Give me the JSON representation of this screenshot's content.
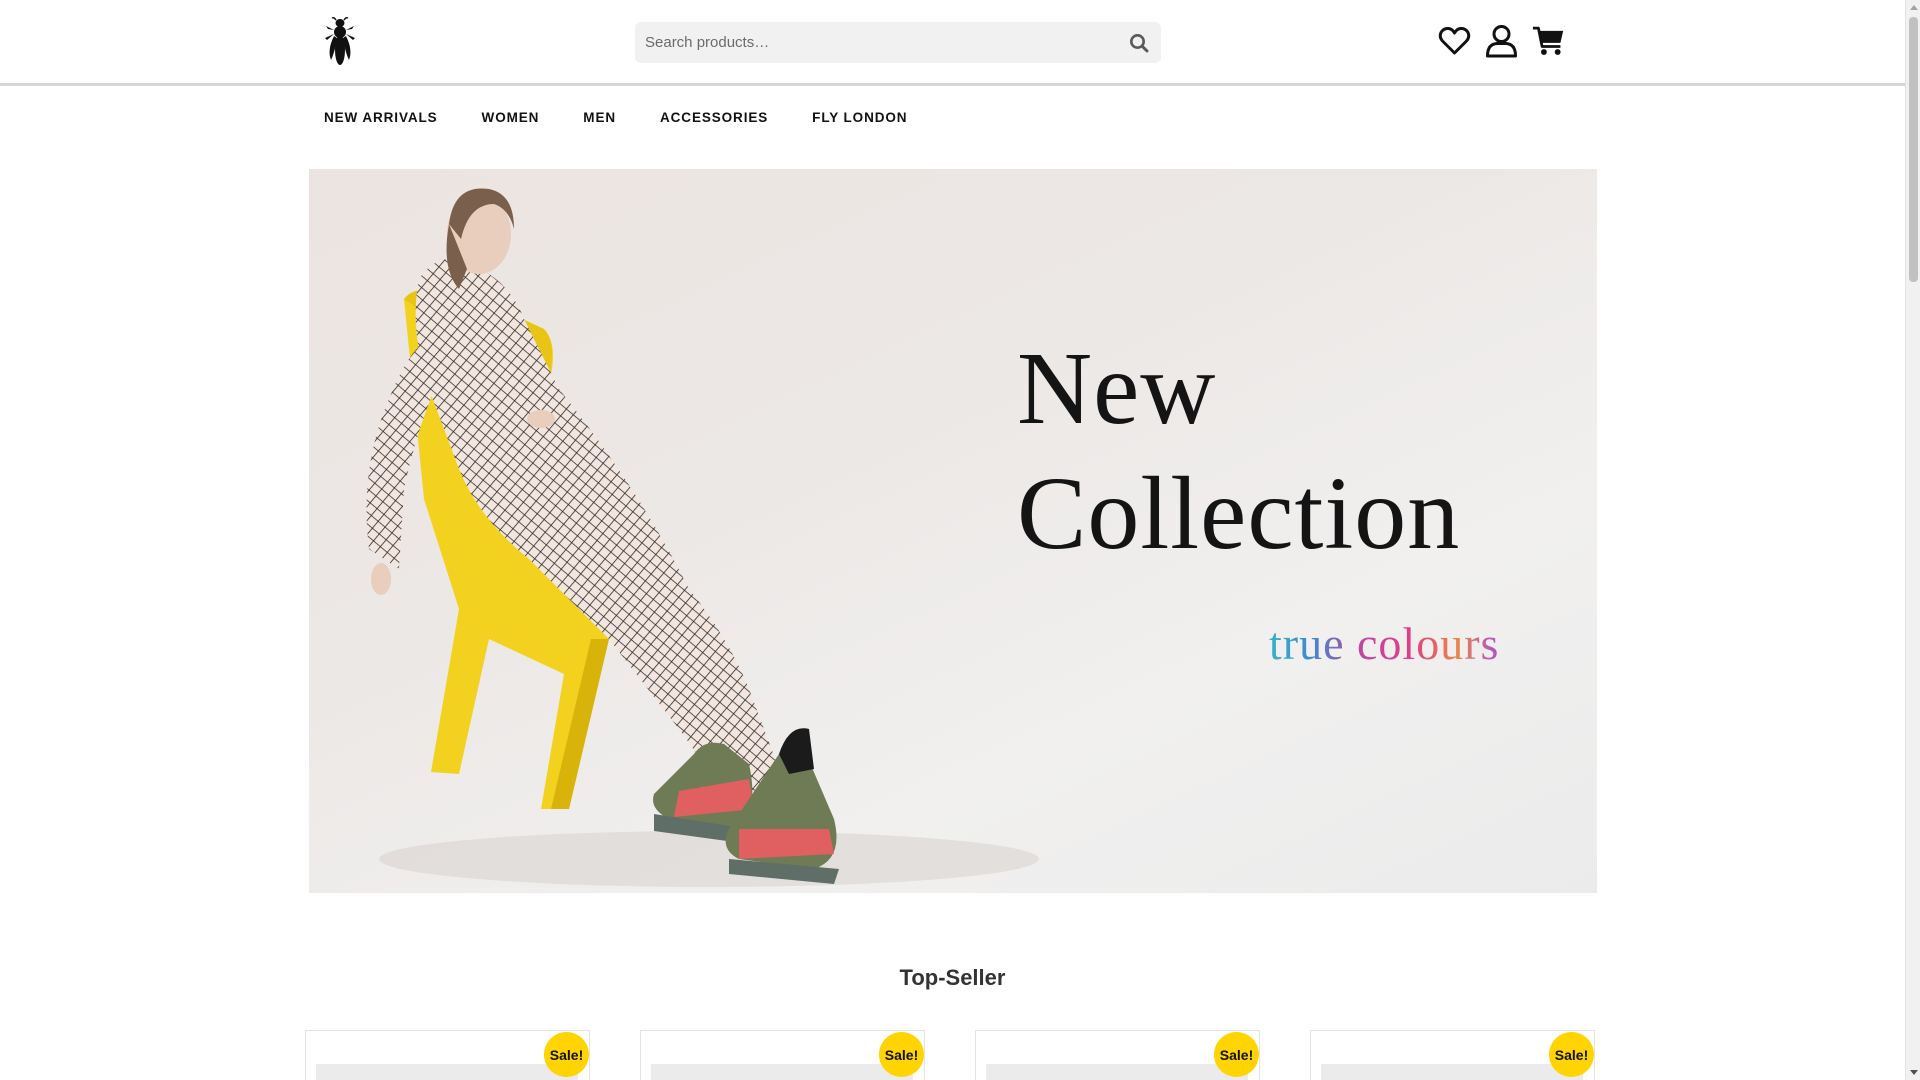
{
  "header": {
    "logo_icon": "fly-insect-logo-icon",
    "search": {
      "placeholder": "Search products…",
      "button_icon": "search-icon"
    },
    "icons": [
      "heart-wishlist-icon",
      "user-account-icon",
      "shopping-cart-icon"
    ]
  },
  "nav": {
    "items": [
      {
        "label": "NEW ARRIVALS"
      },
      {
        "label": "WOMEN"
      },
      {
        "label": "MEN"
      },
      {
        "label": "ACCESSORIES"
      },
      {
        "label": "FLY LONDON"
      }
    ]
  },
  "hero": {
    "title_line_1": "New",
    "title_line_2": "Collection",
    "subtitle": "true colours"
  },
  "top_seller": {
    "title": "Top-Seller",
    "products": [
      {
        "badge": "Sale!"
      },
      {
        "badge": "Sale!"
      },
      {
        "badge": "Sale!"
      },
      {
        "badge": "Sale!"
      }
    ]
  },
  "colors": {
    "badge": "#ffd400",
    "header_border": "#d6d6d6",
    "chair": "#f2d21e"
  }
}
